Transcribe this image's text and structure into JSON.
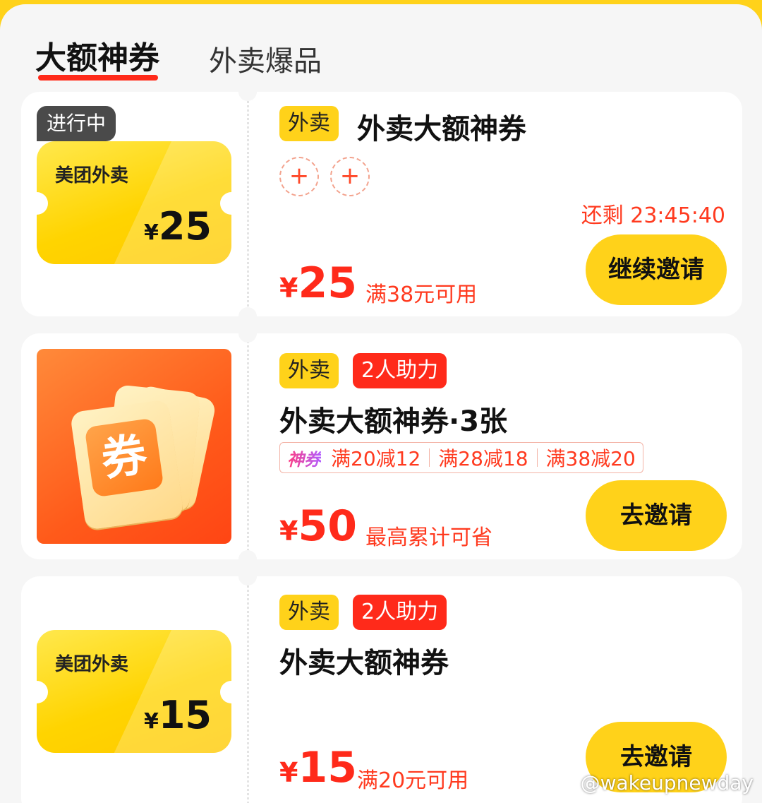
{
  "tabs": [
    {
      "label": "大额神券",
      "active": true
    },
    {
      "label": "外卖爆品",
      "active": false
    }
  ],
  "cards": [
    {
      "status": "进行中",
      "thumb_brand": "美团外卖",
      "thumb_amount": "25",
      "tag": "外卖",
      "title": "外卖大额神券",
      "countdown": "还剩 23:45:40",
      "price_yen": "¥",
      "price": "25",
      "condition": "满38元可用",
      "cta": "继续邀请"
    },
    {
      "tag": "外卖",
      "tag2": "2人助力",
      "title": "外卖大额神券·3张",
      "promo_glyph": "券",
      "rules_badge": "神券",
      "rules": [
        "满20减12",
        "满28减18",
        "满38减20"
      ],
      "price_yen": "¥",
      "price": "50",
      "condition": "最高累计可省",
      "cta": "去邀请"
    },
    {
      "thumb_brand": "美团外卖",
      "thumb_amount": "15",
      "tag": "外卖",
      "tag2": "2人助力",
      "title": "外卖大额神券",
      "price_yen": "¥",
      "price": "15",
      "condition": "满20元可用",
      "cta": "去邀请"
    }
  ],
  "yen": "¥",
  "plus_glyph": "+",
  "watermark": "@wakeupnewday",
  "colors": {
    "brand_yellow": "#ffd21a",
    "accent_red": "#ff2a1a",
    "background": "#f6f6f6"
  }
}
